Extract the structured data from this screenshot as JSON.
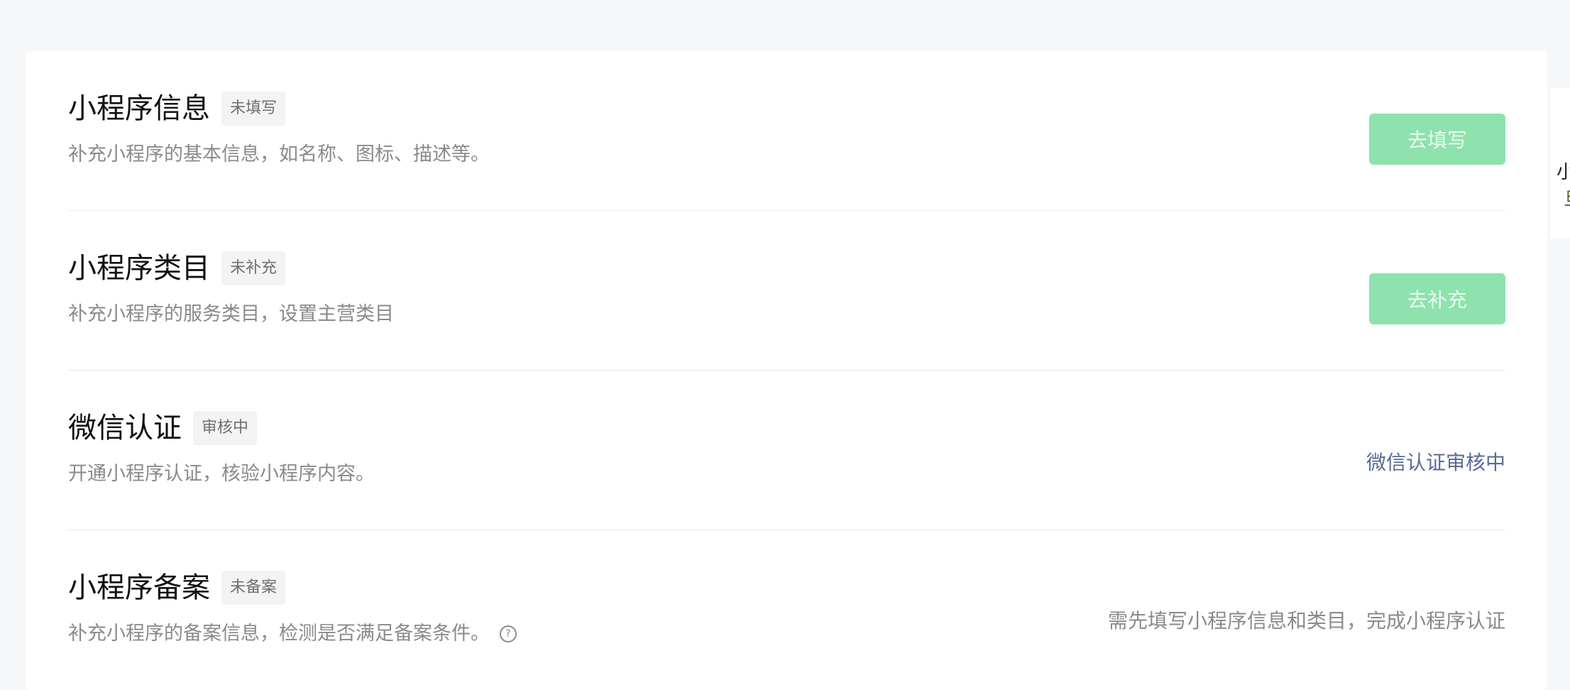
{
  "sections": [
    {
      "title": "小程序信息",
      "badge": "未填写",
      "description": "补充小程序的基本信息，如名称、图标、描述等。",
      "action_label": "去填写"
    },
    {
      "title": "小程序类目",
      "badge": "未补充",
      "description": "补充小程序的服务类目，设置主营类目",
      "action_label": "去补充"
    },
    {
      "title": "微信认证",
      "badge": "审核中",
      "description": "开通小程序认证，核验小程序内容。",
      "status_text": "微信认证审核中"
    },
    {
      "title": "小程序备案",
      "badge": "未备案",
      "description": "补充小程序的备案信息，检测是否满足备案条件。",
      "help_icon": "?",
      "status_text": "需先填写小程序信息和类目，完成小程序认证"
    }
  ],
  "side_tab": {
    "line1": "小",
    "line2": "旦"
  },
  "colors": {
    "primary_disabled": "#8ee2ad",
    "link": "#576b95",
    "muted_text": "#8a8a8a",
    "badge_bg": "#f3f3f3"
  }
}
